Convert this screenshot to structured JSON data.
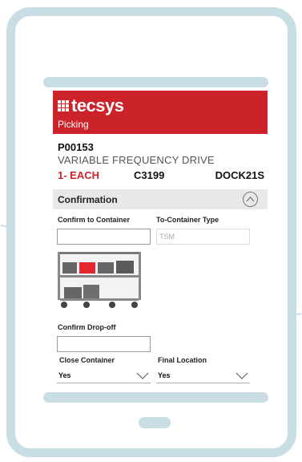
{
  "app": {
    "logo_text": "tecsys",
    "module": "Picking"
  },
  "item": {
    "code": "P00153",
    "description": "VARIABLE FREQUENCY DRIVE",
    "quantity": "1- EACH",
    "location": "C3199",
    "dock": "DOCK21S"
  },
  "section": {
    "title": "Confirmation",
    "expanded": true
  },
  "form": {
    "confirm_container_label": "Confirm to Container",
    "confirm_container_value": "",
    "container_type_label": "To-Container Type",
    "container_type_value": "TSM",
    "dropoff_label": "Confirm Drop-off",
    "dropoff_value": "",
    "close_container_label": "Close Container",
    "close_container_value": "Yes",
    "final_location_label": "Final Location",
    "final_location_value": "Yes"
  },
  "colors": {
    "brand_red": "#cc2229",
    "device_frame": "#c9dde5",
    "section_bg": "#e8e8e8"
  },
  "icons": {
    "logo": "grid-logo-icon",
    "collapse": "chevron-up-circle-icon",
    "dropdown": "chevron-down-icon",
    "cart": "picking-cart-icon"
  }
}
